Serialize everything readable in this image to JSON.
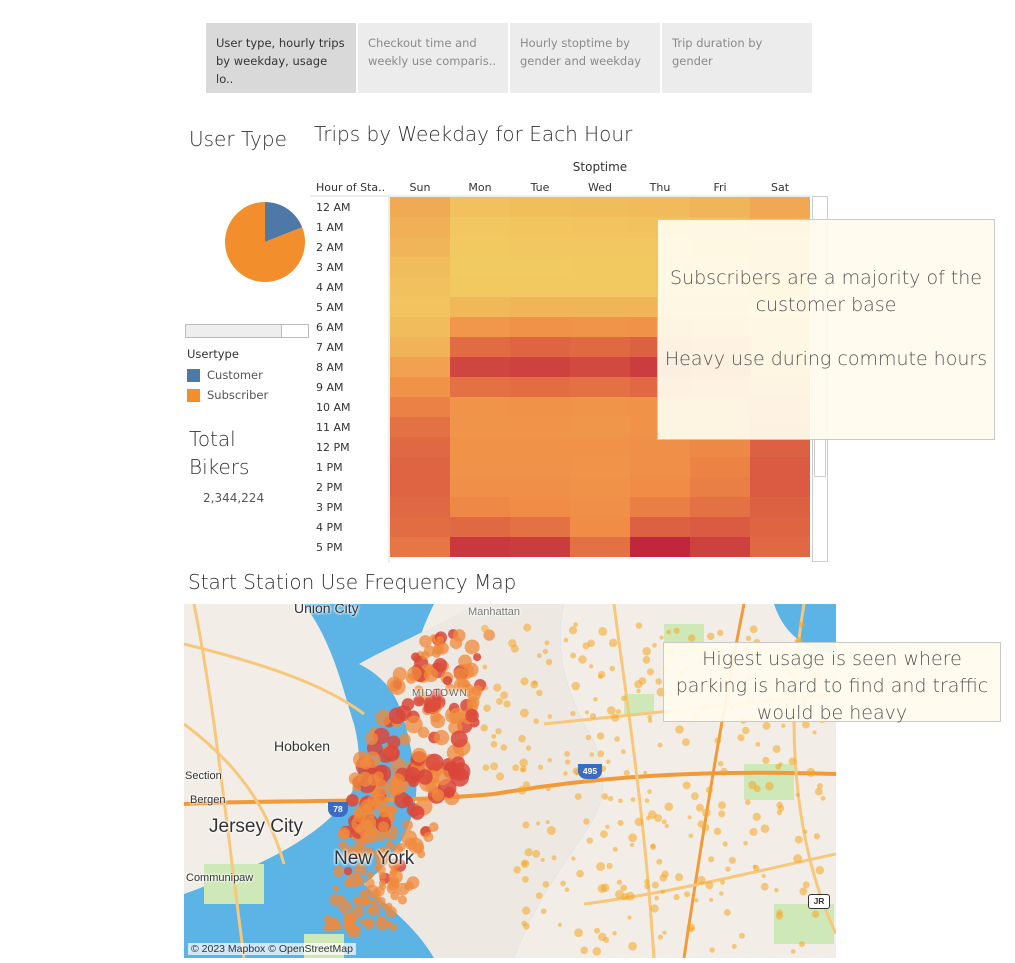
{
  "tabs": [
    {
      "label": "User type, hourly trips by weekday, usage lo..",
      "active": true
    },
    {
      "label": "Checkout time and weekly use comparis..",
      "active": false
    },
    {
      "label": "Hourly stoptime by gender and weekday",
      "active": false
    },
    {
      "label": "Trip duration by gender",
      "active": false
    }
  ],
  "user_type": {
    "title": "User Type",
    "legend_title": "Usertype",
    "legend": [
      {
        "label": "Customer",
        "color": "#4e79a7"
      },
      {
        "label": "Subscriber",
        "color": "#f28e2b"
      }
    ]
  },
  "totals": {
    "title": "Total Bikers",
    "value": "2,344,224"
  },
  "heatmap": {
    "title": "Trips by Weekday for Each Hour",
    "column_group": "Stoptime",
    "row_header": "Hour of Sta..",
    "days": [
      "Sun",
      "Mon",
      "Tue",
      "Wed",
      "Thu",
      "Fri",
      "Sat"
    ],
    "hours": [
      "12 AM",
      "1 AM",
      "2 AM",
      "3 AM",
      "4 AM",
      "5 AM",
      "6 AM",
      "7 AM",
      "8 AM",
      "9 AM",
      "10 AM",
      "11 AM",
      "12 PM",
      "1 PM",
      "2 PM",
      "3 PM",
      "4 PM",
      "5 PM"
    ],
    "color_low": "#f2d165",
    "color_high": "#bd1d3c"
  },
  "chart_data": [
    {
      "type": "pie",
      "title": "User Type",
      "categories": [
        "Customer",
        "Subscriber"
      ],
      "values": [
        0.19,
        0.81
      ],
      "legend": "Usertype"
    },
    {
      "type": "heatmap",
      "title": "Trips by Weekday for Each Hour",
      "xlabel": "Stoptime",
      "ylabel": "Hour of Sta..",
      "x": [
        "Sun",
        "Mon",
        "Tue",
        "Wed",
        "Thu",
        "Fri",
        "Sat"
      ],
      "y": [
        "12 AM",
        "1 AM",
        "2 AM",
        "3 AM",
        "4 AM",
        "5 AM",
        "6 AM",
        "7 AM",
        "8 AM",
        "9 AM",
        "10 AM",
        "11 AM",
        "12 PM",
        "1 PM",
        "2 PM",
        "3 PM",
        "4 PM",
        "5 PM"
      ],
      "values": [
        [
          0.28,
          0.12,
          0.14,
          0.15,
          0.16,
          0.2,
          0.3
        ],
        [
          0.24,
          0.08,
          0.09,
          0.1,
          0.11,
          0.15,
          0.26
        ],
        [
          0.2,
          0.06,
          0.07,
          0.07,
          0.08,
          0.12,
          0.22
        ],
        [
          0.15,
          0.05,
          0.05,
          0.06,
          0.06,
          0.08,
          0.16
        ],
        [
          0.12,
          0.06,
          0.06,
          0.06,
          0.06,
          0.07,
          0.12
        ],
        [
          0.1,
          0.18,
          0.2,
          0.2,
          0.2,
          0.18,
          0.1
        ],
        [
          0.15,
          0.42,
          0.45,
          0.44,
          0.45,
          0.4,
          0.16
        ],
        [
          0.22,
          0.65,
          0.68,
          0.66,
          0.7,
          0.6,
          0.24
        ],
        [
          0.35,
          0.82,
          0.84,
          0.8,
          0.86,
          0.74,
          0.35
        ],
        [
          0.45,
          0.62,
          0.64,
          0.62,
          0.66,
          0.58,
          0.46
        ],
        [
          0.55,
          0.44,
          0.45,
          0.44,
          0.46,
          0.45,
          0.58
        ],
        [
          0.62,
          0.44,
          0.44,
          0.43,
          0.45,
          0.48,
          0.66
        ],
        [
          0.66,
          0.46,
          0.46,
          0.45,
          0.47,
          0.52,
          0.7
        ],
        [
          0.68,
          0.46,
          0.46,
          0.44,
          0.48,
          0.54,
          0.72
        ],
        [
          0.68,
          0.48,
          0.48,
          0.46,
          0.5,
          0.56,
          0.72
        ],
        [
          0.66,
          0.52,
          0.5,
          0.48,
          0.56,
          0.62,
          0.7
        ],
        [
          0.64,
          0.66,
          0.62,
          0.5,
          0.7,
          0.72,
          0.68
        ],
        [
          0.6,
          0.88,
          0.86,
          0.62,
          0.96,
          0.84,
          0.66
        ]
      ]
    }
  ],
  "annotations": {
    "commute_line1": "Subscribers are a majority of the customer base",
    "commute_line2": "Heavy use during commute hours",
    "map_note": "Higest usage is seen where parking is hard to find and traffic would be heavy"
  },
  "map": {
    "title": "Start Station Use Frequency Map",
    "attribution": "© 2023 Mapbox © OpenStreetMap",
    "labels": {
      "union_city": "Union City",
      "manhattan": "Manhattan",
      "midtown": "MIDTOWN",
      "hoboken": "Hoboken",
      "section": "Section",
      "bergen": "Bergen",
      "jersey_city": "Jersey City",
      "new_york": "New York",
      "communipaw": "Communipaw"
    },
    "shields": {
      "i78": "78",
      "i495": "495",
      "jr": "JR"
    }
  }
}
